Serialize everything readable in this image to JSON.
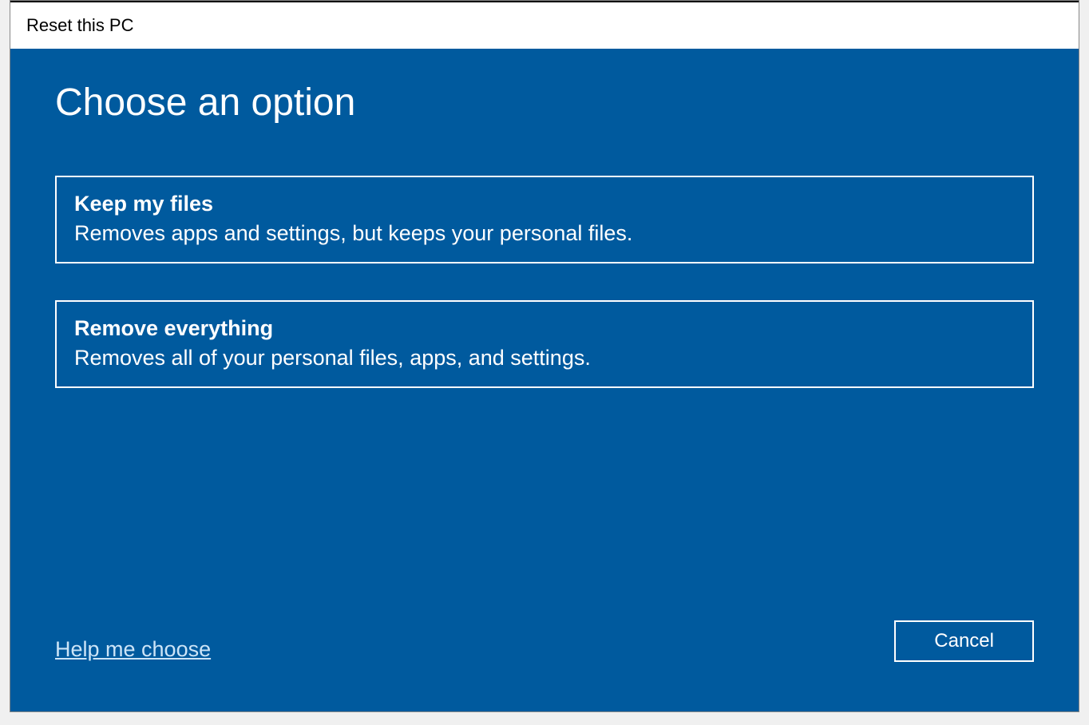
{
  "window": {
    "title": "Reset this PC"
  },
  "main": {
    "heading": "Choose an option",
    "options": [
      {
        "title": "Keep my files",
        "description": "Removes apps and settings, but keeps your personal files."
      },
      {
        "title": "Remove everything",
        "description": "Removes all of your personal files, apps, and settings."
      }
    ]
  },
  "footer": {
    "help_link": "Help me choose",
    "cancel": "Cancel"
  }
}
